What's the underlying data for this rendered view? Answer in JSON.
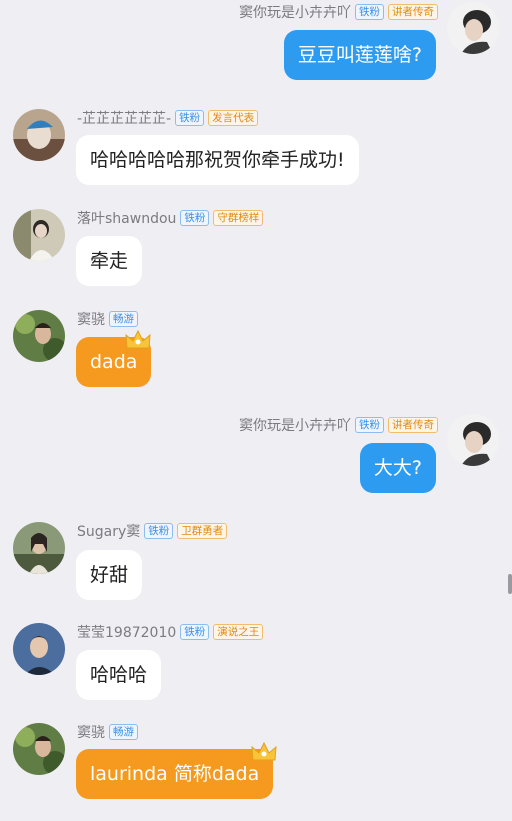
{
  "colors": {
    "background": "#efeef3",
    "self_bubble": "#2d9bf0",
    "other_bubble": "#ffffff",
    "vip_bubble": "#f59a1e",
    "badge_blue": "#3b8fe6",
    "badge_orange": "#e08a12"
  },
  "messages": [
    {
      "sender": "窦你玩是小卉卉吖",
      "fan_badge": "铁粉",
      "title_badge": "讲者传奇",
      "text": "豆豆叫莲莲啥?",
      "side": "right",
      "style": "blue"
    },
    {
      "sender": "-芷芷芷芷芷芷-",
      "fan_badge": "铁粉",
      "title_badge": "发言代表",
      "text": "哈哈哈哈哈那祝贺你牵手成功!",
      "side": "left",
      "style": "white"
    },
    {
      "sender": "落叶shawndou",
      "fan_badge": "铁粉",
      "title_badge": "守群榜样",
      "text": "牵走",
      "side": "left",
      "style": "white"
    },
    {
      "sender": "窦骁",
      "fan_badge": "畅游",
      "title_badge": "",
      "text": "dada",
      "side": "left",
      "style": "orange"
    },
    {
      "sender": "窦你玩是小卉卉吖",
      "fan_badge": "铁粉",
      "title_badge": "讲者传奇",
      "text": "大大?",
      "side": "right",
      "style": "blue"
    },
    {
      "sender": "Sugary窦",
      "fan_badge": "铁粉",
      "title_badge": "卫群勇者",
      "text": "好甜",
      "side": "left",
      "style": "white"
    },
    {
      "sender": "莹莹19872010",
      "fan_badge": "铁粉",
      "title_badge": "演说之王",
      "text": "哈哈哈",
      "side": "left",
      "style": "white"
    },
    {
      "sender": "窦骁",
      "fan_badge": "畅游",
      "title_badge": "",
      "text": "laurinda 简称dada",
      "side": "left",
      "style": "orange"
    }
  ]
}
